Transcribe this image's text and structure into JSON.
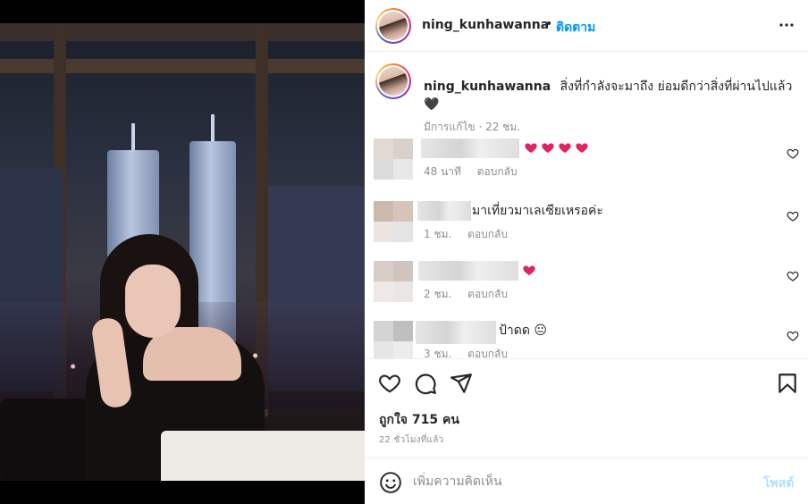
{
  "post": {
    "username": "ning_kunhawanna",
    "follow_label": "ติดตาม",
    "dot": "•",
    "more_icon": "more-horizontal-icon"
  },
  "caption": {
    "username": "ning_kunhawanna",
    "text": "สิ่งที่กำลังจะมาถึง ย่อมดีกว่าสิ่งที่ผ่านไปแล้ว",
    "emoji": "🖤",
    "edited_label": "มีการแก้ไข",
    "separator": "·",
    "time": "22 ชม."
  },
  "comments": [
    {
      "text": "",
      "hearts": 4,
      "time": "48 นาที",
      "reply_label": "ตอบกลับ"
    },
    {
      "text": "มาเที่ยวมาเลเซียเหรอค่ะ",
      "hearts": 0,
      "time": "1 ชม.",
      "reply_label": "ตอบกลับ"
    },
    {
      "text": "",
      "hearts": 1,
      "time": "2 ชม.",
      "reply_label": "ตอบกลับ"
    },
    {
      "text": "ป้าดด",
      "hearts": 0,
      "emoji": "😐",
      "time": "3 ชม.",
      "reply_label": "ตอบกลับ"
    }
  ],
  "actions": {
    "like_icon": "heart-outline-icon",
    "comment_icon": "comment-bubble-icon",
    "share_icon": "paper-plane-icon",
    "save_icon": "bookmark-icon",
    "likes_label": "ถูกใจ 715 คน",
    "time_ago": "22 ชั่วโมงที่แล้ว"
  },
  "add_comment": {
    "emoji_icon": "smiley-icon",
    "placeholder": "เพิ่มความคิดเห็น",
    "post_label": "โพสต์"
  },
  "colors": {
    "accent": "#0095f6",
    "post_disabled": "#b2dffc",
    "heart_red": "#ed4956",
    "muted": "#8e8e8e"
  }
}
